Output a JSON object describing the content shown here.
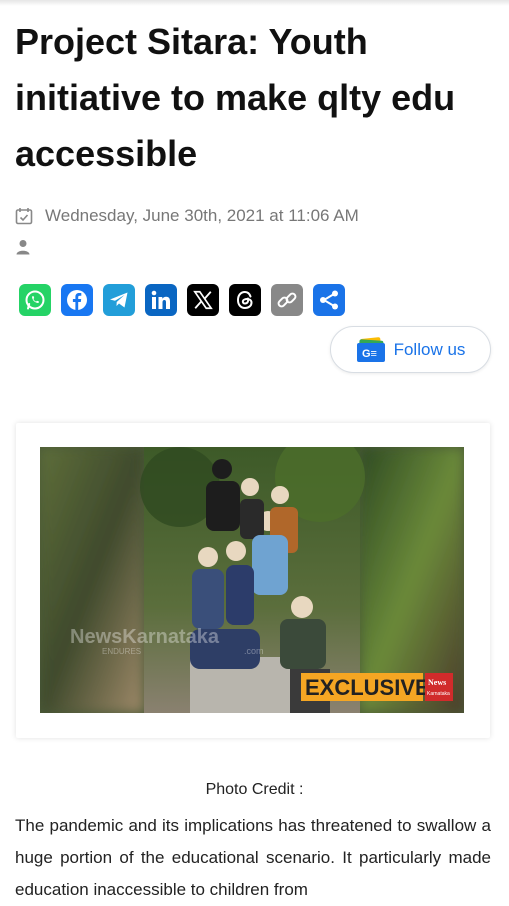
{
  "article": {
    "title": "Project Sitara: Youth initiative to make qlty edu accessible",
    "date": "Wednesday, June 30th, 2021 at 11:06 AM",
    "photo_credit": "Photo Credit :",
    "body": "The pandemic and its implications has threatened to swallow a huge portion of the educational scenario. It particularly made education inaccessible to children from"
  },
  "share": {
    "buttons": [
      {
        "name": "whatsapp",
        "color": "#25D366"
      },
      {
        "name": "facebook",
        "color": "#1877F2"
      },
      {
        "name": "telegram",
        "color": "#229ED9"
      },
      {
        "name": "linkedin",
        "color": "#0A66C2"
      },
      {
        "name": "x",
        "color": "#000000"
      },
      {
        "name": "threads",
        "color": "#000000"
      },
      {
        "name": "copy-link",
        "color": "#888888"
      },
      {
        "name": "share",
        "color": "#1A73E8"
      }
    ]
  },
  "follow": {
    "label": "Follow us",
    "icon_text": "G≡",
    "accent": "#1a73e8"
  },
  "image": {
    "watermark": "NewsKarnataka",
    "watermark_sub": "ENDURES",
    "watermark_domain": ".com",
    "badge": "EXCLUSIVE",
    "logo_line1": "News",
    "logo_line2": "Karnataka"
  }
}
